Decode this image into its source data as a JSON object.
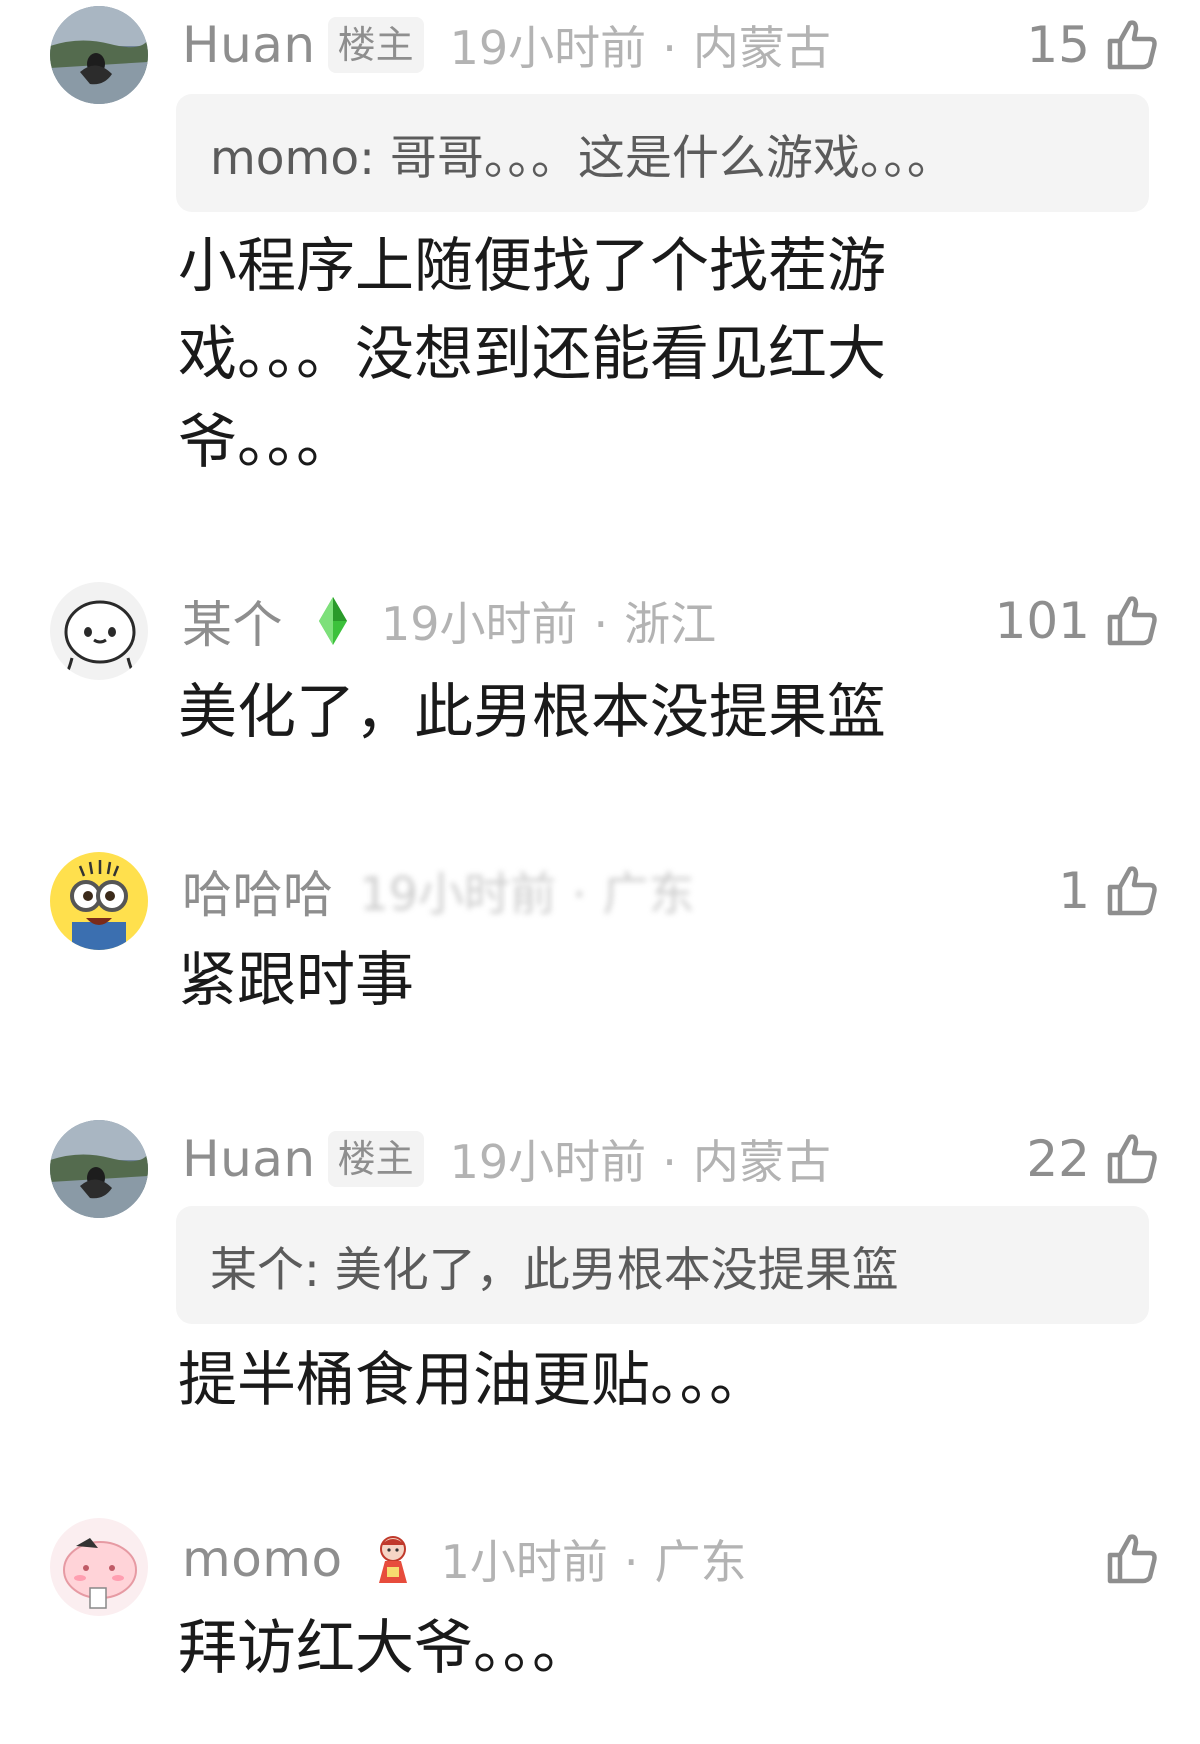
{
  "comments": [
    {
      "username": "Huan",
      "op_badge": "楼主",
      "time": "19小时前",
      "location": "内蒙古",
      "likes": "15",
      "quote": "momo: 哥哥。。。这是什么游戏。。。",
      "lines": [
        "小程序上随便找了个找茬游",
        "戏。。。没想到还能看见红大",
        "爷。。。"
      ]
    },
    {
      "username": "某个",
      "badge_icon": "green-diamond-icon",
      "time": "19小时前",
      "location": "浙江",
      "likes": "101",
      "lines": [
        "美化了，此男根本没提果篮"
      ]
    },
    {
      "username": "哈哈哈",
      "time": "19小时前",
      "location": "广东",
      "likes": "1",
      "lines": [
        "紧跟时事"
      ]
    },
    {
      "username": "Huan",
      "op_badge": "楼主",
      "time": "19小时前",
      "location": "内蒙古",
      "likes": "22",
      "quote": "某个: 美化了，此男根本没提果篮",
      "lines": [
        "提半桶食用油更贴。。。"
      ]
    },
    {
      "username": "momo",
      "badge_icon": "doll-sticker-icon",
      "time": "1小时前",
      "location": "广东",
      "likes": "",
      "lines": [
        "拜访红大爷。。。"
      ]
    }
  ],
  "colors": {
    "username": "#8e8e8e",
    "meta": "#b3b3b3",
    "body": "#1a1a1a",
    "quote_bg": "#f4f4f4",
    "badge_green": "#3cc13b"
  }
}
